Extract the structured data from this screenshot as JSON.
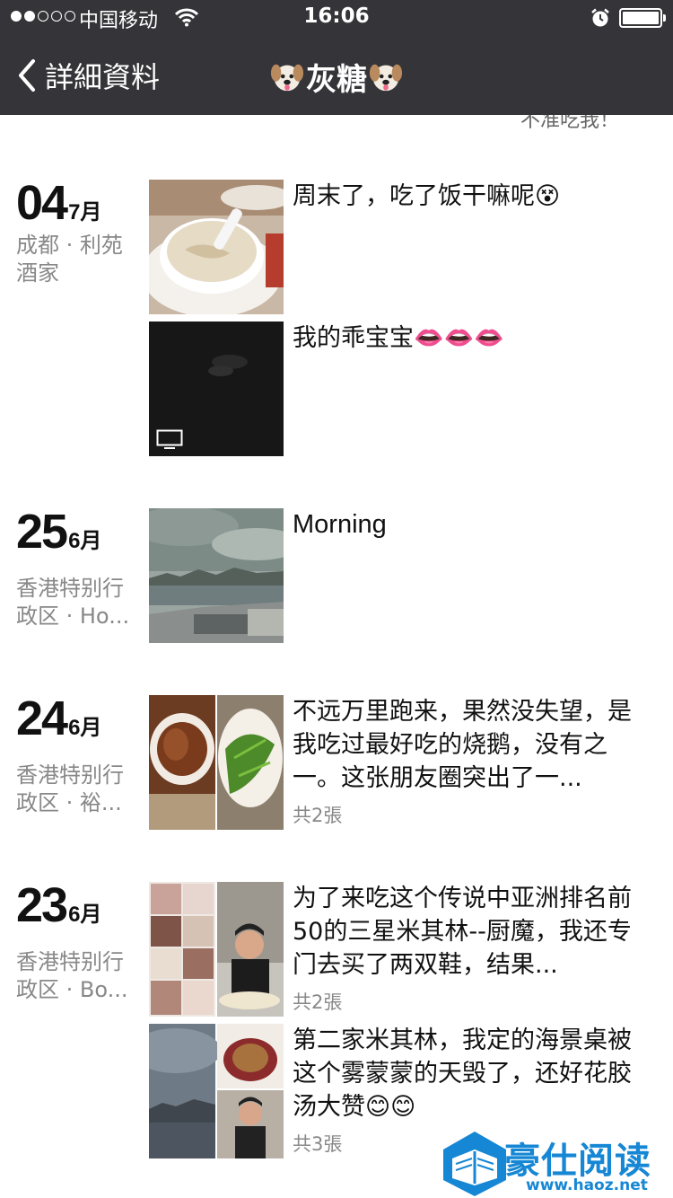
{
  "status": {
    "carrier": "中国移动",
    "time": "16:06",
    "signal_icon": "signal-dots-icon",
    "wifi_icon": "wifi-icon",
    "alarm_icon": "alarm-icon",
    "battery_icon": "battery-icon"
  },
  "nav": {
    "back_label": "詳細資料",
    "title": "灰糖",
    "title_emoji": "dog-face-icon"
  },
  "peek_text": "不准吃我！",
  "entries": [
    {
      "day": "04",
      "month": "7月",
      "location": "成都 · 利苑酒家",
      "posts": [
        {
          "text": "周末了，吃了饭干嘛呢😵",
          "count": ""
        },
        {
          "text": "我的乖宝宝👄👄👄",
          "count": "",
          "video": true
        }
      ]
    },
    {
      "day": "25",
      "month": "6月",
      "location": "香港特别行政区 · Ho...",
      "posts": [
        {
          "text": "Morning",
          "count": ""
        }
      ]
    },
    {
      "day": "24",
      "month": "6月",
      "location": "香港特别行政区 · 裕...",
      "posts": [
        {
          "text": "不远万里跑来，果然没失望，是我吃过最好吃的烧鹅，没有之一。这张朋友圈突出了一...",
          "count": "共2張"
        }
      ]
    },
    {
      "day": "23",
      "month": "6月",
      "location": "香港特别行政区 · Bo...",
      "posts": [
        {
          "text": "为了来吃这个传说中亚洲排名前50的三星米其林--厨魔，我还专门去买了两双鞋，结果...",
          "count": "共2張"
        },
        {
          "text": "第二家米其林，我定的海景桌被这个雾蒙蒙的天毁了，还好花胶汤大赞😊😊",
          "count": "共3張"
        }
      ]
    }
  ],
  "watermark": {
    "text": "豪仕阅读",
    "url": "www.haoz.net",
    "logo_icon": "book-logo-icon"
  },
  "colors": {
    "navbar": "#353539",
    "watermark": "#1687d4"
  }
}
